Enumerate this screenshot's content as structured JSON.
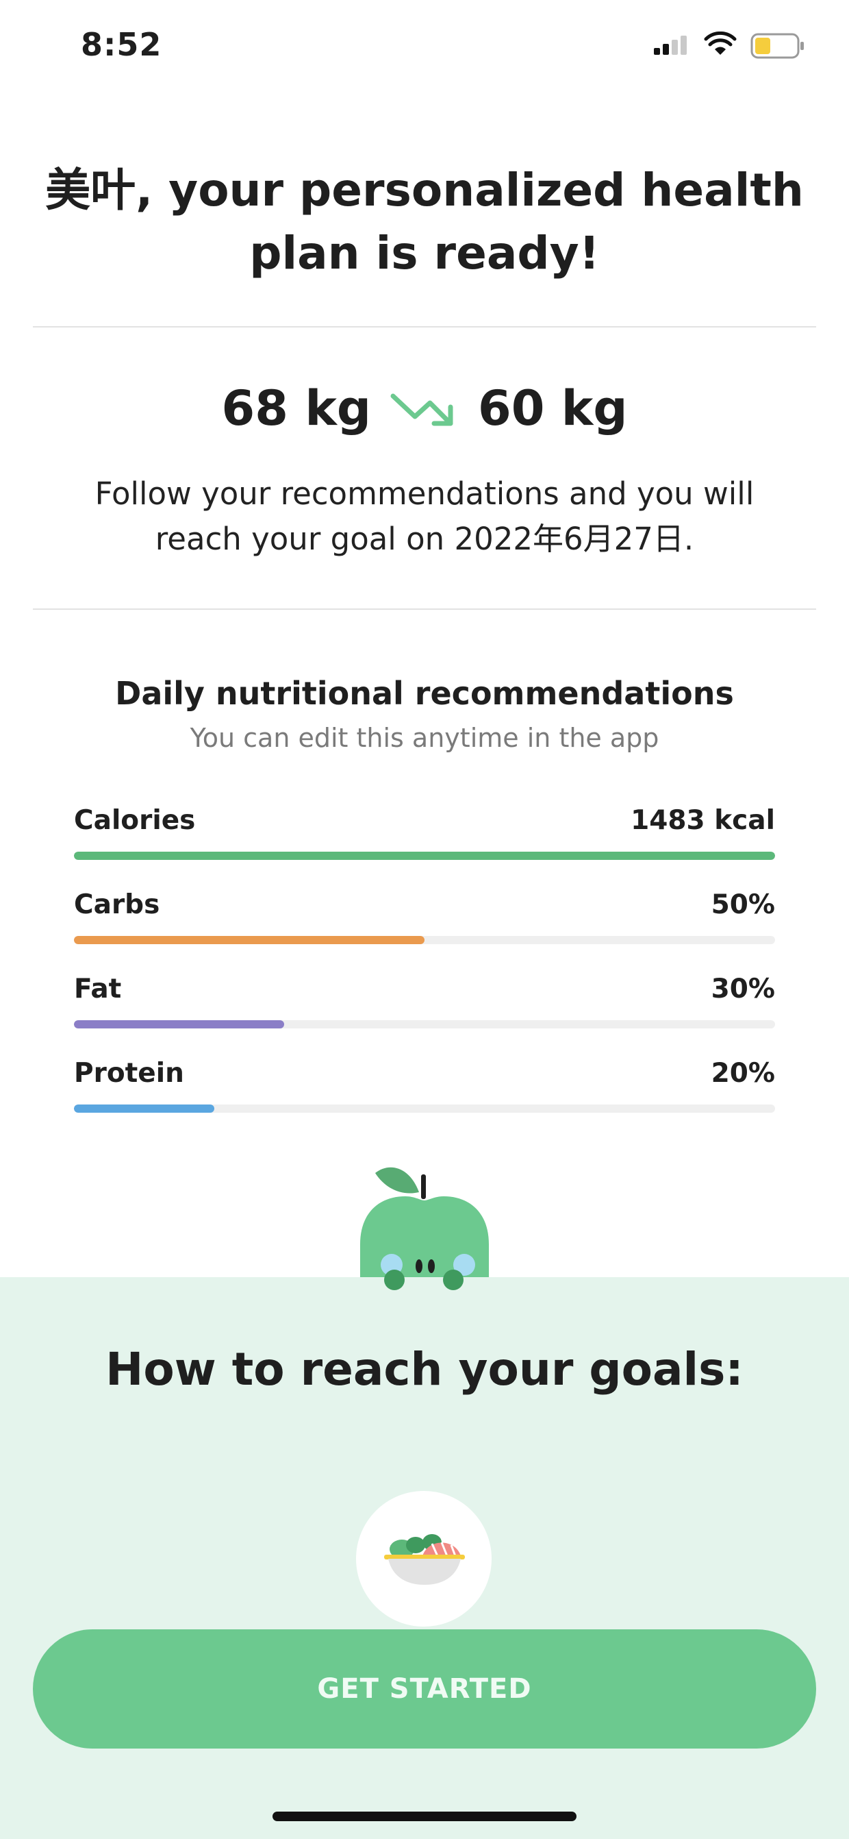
{
  "status_bar": {
    "time": "8:52"
  },
  "header": {
    "title": "美叶, your personalized health plan is ready!"
  },
  "weight": {
    "current": "68 kg",
    "target": "60 kg",
    "trend_icon": "trend-down-arrow-icon"
  },
  "goal_message": "Follow your recommendations and you will reach your goal on 2022年6月27日.",
  "nutrition": {
    "title": "Daily nutritional recommendations",
    "subtitle": "You can edit this anytime in the app",
    "items": [
      {
        "label": "Calories",
        "value": "1483 kcal",
        "fraction": 1.0,
        "color": "#5cb87a"
      },
      {
        "label": "Carbs",
        "value": "50%",
        "fraction": 0.5,
        "color": "#ea9a4e"
      },
      {
        "label": "Fat",
        "value": "30%",
        "fraction": 0.3,
        "color": "#8b7ec7"
      },
      {
        "label": "Protein",
        "value": "20%",
        "fraction": 0.2,
        "color": "#5aa6e0"
      }
    ]
  },
  "goals": {
    "title": "How to reach your goals:",
    "icon": "salad-bowl-icon"
  },
  "cta": {
    "label": "GET STARTED"
  },
  "colors": {
    "accent": "#6cc98f",
    "section_bg": "#e4f4ec",
    "battery": "#f5cd3d"
  }
}
